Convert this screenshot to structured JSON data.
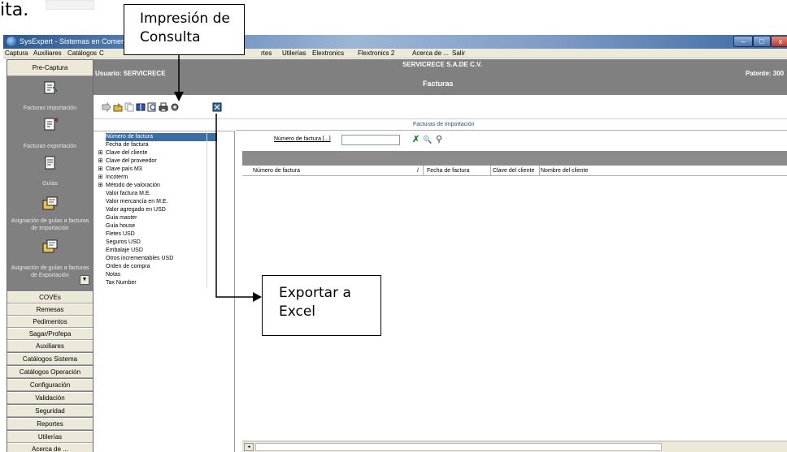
{
  "fragment_text": "ita.",
  "window": {
    "title": "SysExpert - Sistemas en Comercio",
    "min_glyph": "–",
    "max_glyph": "□",
    "close_glyph": "x"
  },
  "menu": [
    "Captura",
    "Auxiliares",
    "Catálogos",
    "C",
    "rtes",
    "Utilerías",
    "Elextronics",
    "Flextronics 2",
    "Acerca de ...",
    "Salir"
  ],
  "nav": {
    "header": "Pre-Captura",
    "items": [
      {
        "label": "Facturas importación",
        "icon": "invoice-import-icon"
      },
      {
        "label": "Facturas exportación",
        "icon": "invoice-export-icon"
      },
      {
        "label": "Guías",
        "icon": "guide-document-icon"
      },
      {
        "label": "Asignación de guías a facturas de Importación",
        "icon": "assign-guides-import-icon"
      },
      {
        "label": "Asignación de guías a facturas de Exportación",
        "icon": "assign-guides-export-icon"
      }
    ],
    "scroll_glyph": "▼",
    "buttons": [
      "COVEs",
      "Remesas",
      "Pedimentos",
      "Sagar/Profepa",
      "Auxiliares",
      "Catálogos Sistema",
      "Catálogos Operación",
      "Configuración",
      "Validación",
      "Seguridad",
      "Reportes",
      "Utilerías",
      "Acerca de ..."
    ]
  },
  "header": {
    "usuario": "Usuario: SERVICRECE",
    "company": "SERVICRECE S.A.DE C.V.",
    "section": "Facturas",
    "patente": "Patente: 300"
  },
  "toolbar": {
    "icons": [
      "next-icon",
      "open-folder-icon",
      "copy-icon",
      "book-icon",
      "query-icon",
      "print-icon",
      "settings-icon",
      "excel-export-icon"
    ]
  },
  "fields": [
    {
      "label": "Número de factura",
      "expand": "",
      "selected": true
    },
    {
      "label": "Fecha de factura",
      "expand": ""
    },
    {
      "label": "Clave del cliente",
      "expand": "⊞"
    },
    {
      "label": "Clave del proveedor",
      "expand": "⊞"
    },
    {
      "label": "Clave país M3",
      "expand": "⊞"
    },
    {
      "label": "Incoterm",
      "expand": "⊞"
    },
    {
      "label": "Método de valoración",
      "expand": "⊞"
    },
    {
      "label": "Valor factura M.E.",
      "expand": ""
    },
    {
      "label": "Valor mercancía en M.E.",
      "expand": ""
    },
    {
      "label": "Valor agregado en USD",
      "expand": ""
    },
    {
      "label": "Guía master",
      "expand": ""
    },
    {
      "label": "Guía house",
      "expand": ""
    },
    {
      "label": "Fletes USD",
      "expand": ""
    },
    {
      "label": "Seguros USD",
      "expand": ""
    },
    {
      "label": "Embalaje USD",
      "expand": ""
    },
    {
      "label": "Otros incrementables USD",
      "expand": ""
    },
    {
      "label": "Orden de compra",
      "expand": ""
    },
    {
      "label": "Notas",
      "expand": ""
    },
    {
      "label": "Tax Number",
      "expand": ""
    }
  ],
  "main": {
    "section_title": "Facturas de Importación",
    "filter_label": "Número de factura  [...]",
    "filter_value": "",
    "filter_icons": {
      "clear": "✗",
      "search_key": "🔍",
      "find": "⚲"
    },
    "columns": [
      "Número de factura",
      "/",
      "Fecha de factura",
      "Clave del cliente",
      "Nombre del cliente"
    ],
    "scroll_left": "◂"
  },
  "callouts": {
    "print_query": "Impresión de Consulta",
    "export_excel": "Exportar a Excel"
  }
}
